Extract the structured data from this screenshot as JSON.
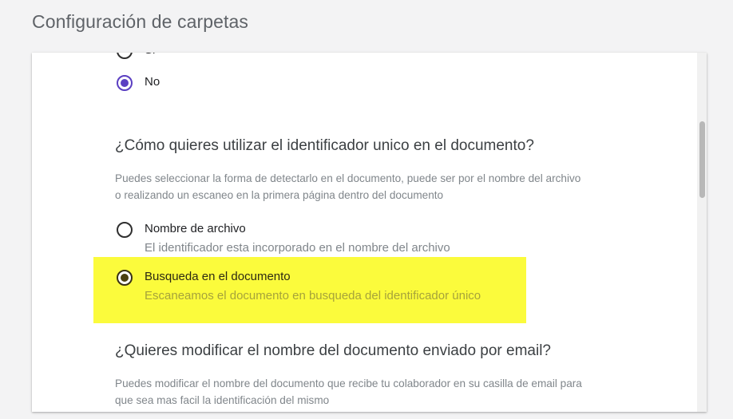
{
  "page": {
    "title": "Configuración de carpetas"
  },
  "options_prev": {
    "partial_label": "Si",
    "no_label": "No",
    "selected": "No"
  },
  "identifier_section": {
    "question": "¿Cómo quieres utilizar el identificador unico en el documento?",
    "helper_line1": "Puedes seleccionar la forma de detectarlo en el documento, puede ser por el nombre del archivo",
    "helper_line2": "o realizando un escaneo en la primera página dentro del documento",
    "options": [
      {
        "label": "Nombre de archivo",
        "description": "El identificador esta incorporado en el nombre del archivo",
        "selected": false
      },
      {
        "label": "Busqueda en el documento",
        "description": "Escaneamos el documento en busqueda del identificador único",
        "selected": true
      }
    ]
  },
  "rename_section": {
    "question": "¿Quieres modificar el nombre del documento enviado por email?",
    "helper_line1": "Puedes modificar el nombre del documento que recibe tu colaborador en su casilla de email para",
    "helper_line2": "que sea mas facil la identificación del mismo"
  },
  "colors": {
    "accent_radio": "#5b3fc2",
    "highlight": "#fbfb3c"
  }
}
